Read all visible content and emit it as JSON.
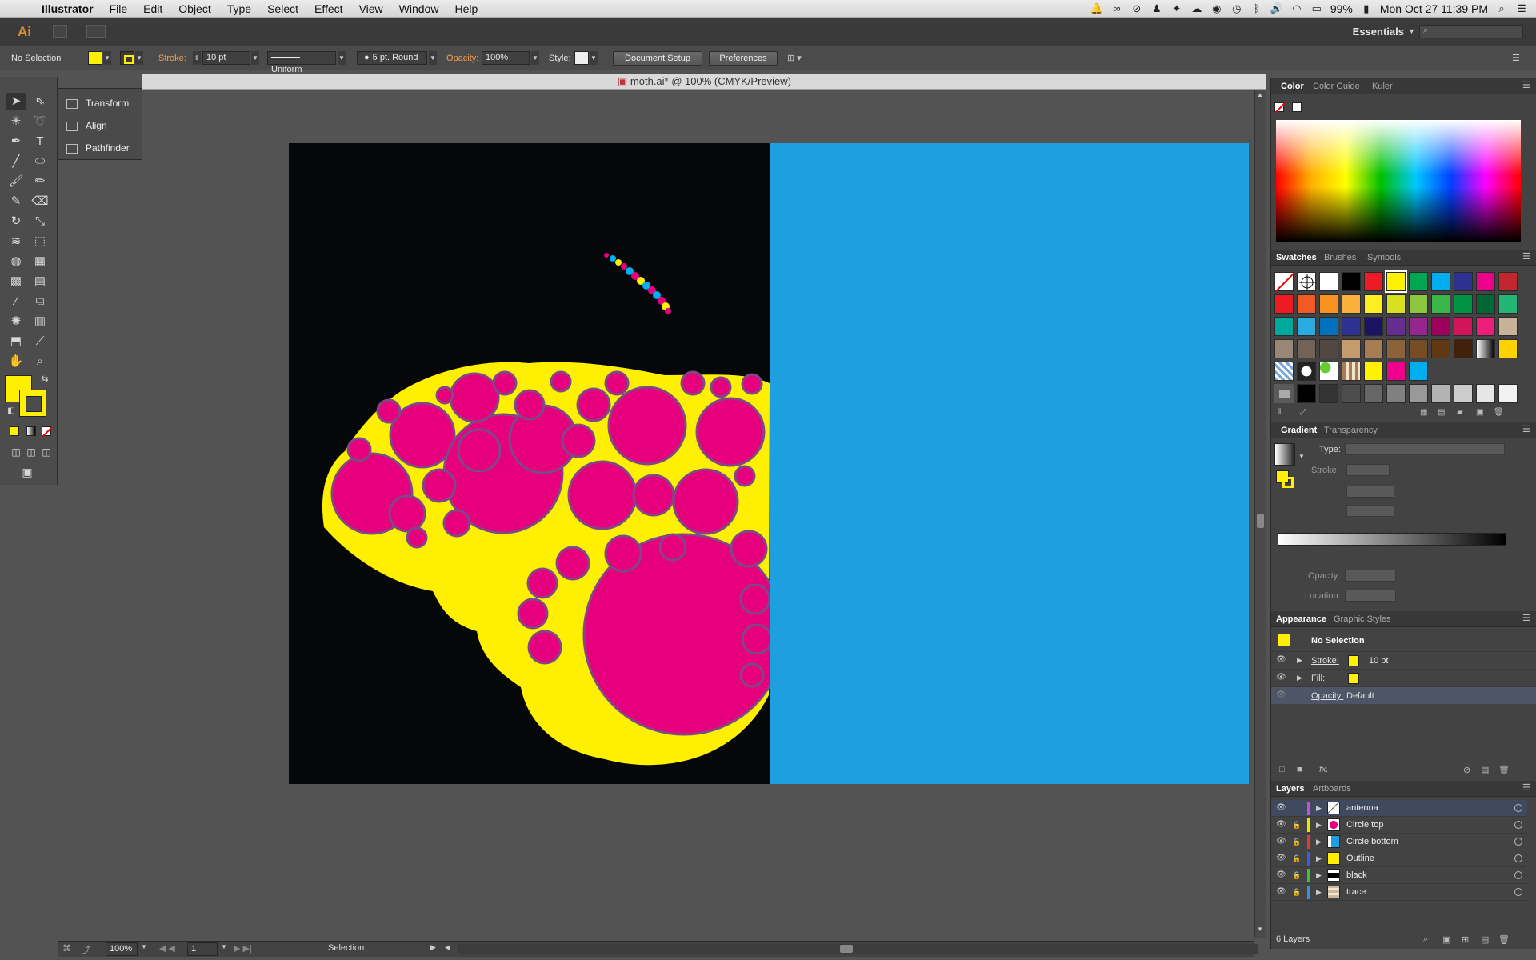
{
  "menubar": {
    "app_name": "Illustrator",
    "items": [
      "File",
      "Edit",
      "Object",
      "Type",
      "Select",
      "Effect",
      "View",
      "Window",
      "Help"
    ],
    "battery": "99%",
    "datetime": "Mon Oct 27  11:39 PM"
  },
  "appbar": {
    "logo": "Ai",
    "workspace": "Essentials"
  },
  "control": {
    "selection_status": "No Selection",
    "stroke_label": "Stroke:",
    "stroke_value": "10 pt",
    "profile": "Uniform",
    "brush": "5 pt. Round",
    "opacity_label": "Opacity:",
    "opacity_value": "100%",
    "style_label": "Style:",
    "doc_setup": "Document Setup",
    "preferences": "Preferences"
  },
  "flyout": {
    "items": [
      "Transform",
      "Align",
      "Pathfinder"
    ]
  },
  "document": {
    "title": "moth.ai* @ 100% (CMYK/Preview)"
  },
  "colors": {
    "fill": "#ffef00",
    "stroke": "#ffef00",
    "moth_body": "#e6007e",
    "artboard_right": "#1e9fe0",
    "artboard_left": "#060708"
  },
  "statusbar": {
    "zoom": "100%",
    "page": "1",
    "tool": "Selection"
  },
  "color_panel": {
    "tabs": [
      "Color",
      "Color Guide",
      "Kuler"
    ]
  },
  "swatches_panel": {
    "tabs": [
      "Swatches",
      "Brushes",
      "Symbols"
    ],
    "rows": [
      [
        "none",
        "reg",
        "#ffffff",
        "#000000",
        "#ed1c24",
        "#fff200",
        "#00a651",
        "#00aeef",
        "#2e3192",
        "#ec008c",
        "#c1272d"
      ],
      [
        "#ed1c24",
        "#f15a24",
        "#f7931e",
        "#fbb03b",
        "#fcee21",
        "#d9e021",
        "#8cc63f",
        "#39b54a",
        "#009245",
        "#006837",
        "#22b573"
      ],
      [
        "#00a99d",
        "#29abe2",
        "#0071bc",
        "#2e3192",
        "#1b1464",
        "#662d91",
        "#93278f",
        "#9e005d",
        "#d4145a",
        "#ed1e79",
        "#c7b299"
      ],
      [
        "#998675",
        "#736357",
        "#534741",
        "#c69c6d",
        "#a67c52",
        "#8c6239",
        "#754c24",
        "#603813",
        "#42210b",
        "grad",
        "#ffd200"
      ],
      [
        "pattern1",
        "pattern2",
        "pattern3",
        "pattern4",
        "#fff200",
        "#ec008c",
        "#00aeef",
        "",
        "",
        "",
        ""
      ],
      [
        "folder",
        "#000000",
        "#333333",
        "#4d4d4d",
        "#666666",
        "#808080",
        "#999999",
        "#b3b3b3",
        "#cccccc",
        "#e6e6e6",
        "#f2f2f2"
      ]
    ]
  },
  "gradient_panel": {
    "tabs": [
      "Gradient",
      "Transparency"
    ],
    "type_label": "Type:",
    "stroke_label": "Stroke:",
    "opacity_label": "Opacity:",
    "location_label": "Location:"
  },
  "appearance_panel": {
    "tabs": [
      "Appearance",
      "Graphic Styles"
    ],
    "title": "No Selection",
    "stroke_label": "Stroke:",
    "stroke_value": "10 pt",
    "fill_label": "Fill:",
    "opacity_label": "Opacity:",
    "opacity_value": "Default"
  },
  "layers_panel": {
    "tabs": [
      "Layers",
      "Artboards"
    ],
    "layers": [
      {
        "name": "antenna",
        "color": "#c84fd8",
        "locked": false,
        "thumb": "antenna"
      },
      {
        "name": "Circle top",
        "color": "#e6e600",
        "locked": true,
        "thumb": "pink"
      },
      {
        "name": "Circle bottom",
        "color": "#e03a3a",
        "locked": true,
        "thumb": "blue"
      },
      {
        "name": "Outline",
        "color": "#3b5de0",
        "locked": true,
        "thumb": "yellow"
      },
      {
        "name": "black",
        "color": "#3ac43a",
        "locked": true,
        "thumb": "black"
      },
      {
        "name": "trace",
        "color": "#3a8fe0",
        "locked": true,
        "thumb": "trace"
      }
    ],
    "count": "6 Layers"
  }
}
